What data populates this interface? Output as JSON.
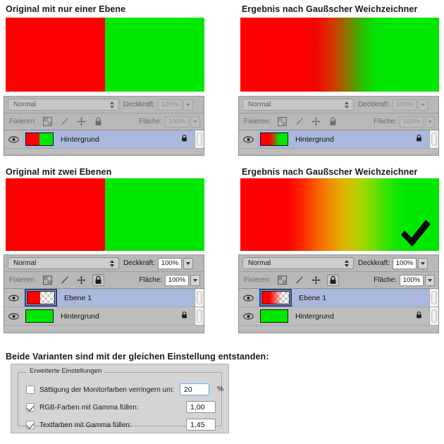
{
  "sections": [
    {
      "id": "top-left",
      "title": "Original mit nur einer Ebene",
      "image_kind": "hard-split-red-green",
      "panel": {
        "blend_mode": "Normal",
        "opacity_label": "Deckkraft:",
        "opacity_value": "100%",
        "lock_label": "Fixieren:",
        "fill_label": "Fläche:",
        "fill_value": "100%",
        "enabled": false,
        "lock_all_pressed": false,
        "lock_icons": [
          "transparency-checker-icon",
          "brush-icon",
          "move-icon",
          "lock-icon"
        ],
        "layers": [
          {
            "name": "Hintergrund",
            "thumb": "split-red-green",
            "selected": true,
            "locked": true,
            "active_thumb": false,
            "visible": true
          }
        ]
      }
    },
    {
      "id": "top-right",
      "title": "Ergebnis nach Gaußscher Weichzeichner",
      "image_kind": "dark-gradient",
      "panel": {
        "blend_mode": "Normal",
        "opacity_label": "Deckkraft:",
        "opacity_value": "100%",
        "lock_label": "Fixieren:",
        "fill_label": "Fläche:",
        "fill_value": "100%",
        "enabled": false,
        "lock_all_pressed": false,
        "lock_icons": [
          "transparency-checker-icon",
          "brush-icon",
          "move-icon",
          "lock-icon"
        ],
        "layers": [
          {
            "name": "Hintergrund",
            "thumb": "dark-gradient",
            "selected": true,
            "locked": true,
            "active_thumb": false,
            "visible": true
          }
        ]
      }
    },
    {
      "id": "bottom-left",
      "title": "Original mit zwei Ebenen",
      "image_kind": "hard-split-red-green",
      "panel": {
        "blend_mode": "Normal",
        "opacity_label": "Deckkraft:",
        "opacity_value": "100%",
        "lock_label": "Fixieren:",
        "fill_label": "Fläche:",
        "fill_value": "100%",
        "enabled": true,
        "lock_all_pressed": true,
        "lock_icons": [
          "transparency-checker-icon",
          "brush-icon",
          "move-icon",
          "lock-icon"
        ],
        "layers": [
          {
            "name": "Ebene 1",
            "thumb": "red-to-transparent-hard",
            "selected": true,
            "locked": false,
            "active_thumb": true,
            "visible": true
          },
          {
            "name": "Hintergrund",
            "thumb": "green",
            "selected": false,
            "locked": true,
            "active_thumb": false,
            "visible": true
          }
        ]
      }
    },
    {
      "id": "bottom-right",
      "title": "Ergebnis nach Gaußscher Weichzeichner",
      "image_kind": "bright-gradient",
      "has_checkmark": true,
      "panel": {
        "blend_mode": "Normal",
        "opacity_label": "Deckkraft:",
        "opacity_value": "100%",
        "lock_label": "Fixieren:",
        "fill_label": "Fläche:",
        "fill_value": "100%",
        "enabled": true,
        "lock_all_pressed": true,
        "lock_icons": [
          "transparency-checker-icon",
          "brush-icon",
          "move-icon",
          "lock-icon"
        ],
        "layers": [
          {
            "name": "Ebene 1",
            "thumb": "red-to-transparent-soft",
            "selected": true,
            "locked": false,
            "active_thumb": true,
            "visible": true
          },
          {
            "name": "Hintergrund",
            "thumb": "green",
            "selected": false,
            "locked": true,
            "active_thumb": false,
            "visible": true
          }
        ]
      }
    }
  ],
  "footer": {
    "heading": "Beide Varianten sind mit der gleichen Einstellung entstanden:",
    "settings": {
      "group_legend": "Erweiterte Einstellungen",
      "rows": [
        {
          "label": "Sättigung der Monitorfarben verringern um:",
          "checked": false,
          "value": "20",
          "suffix": "%",
          "focused": true
        },
        {
          "label": "RGB-Farben mit Gamma füllen:",
          "checked": true,
          "value": "1,00",
          "suffix": "",
          "focused": false
        },
        {
          "label": "Textfarben mit Gamma füllen:",
          "checked": true,
          "value": "1,45",
          "suffix": "",
          "focused": false
        }
      ]
    }
  },
  "colors": {
    "red": "#fe0000",
    "green": "#00e800",
    "panel_gray": "#b8b8b8",
    "selection_blue": "#a9b8dc"
  }
}
